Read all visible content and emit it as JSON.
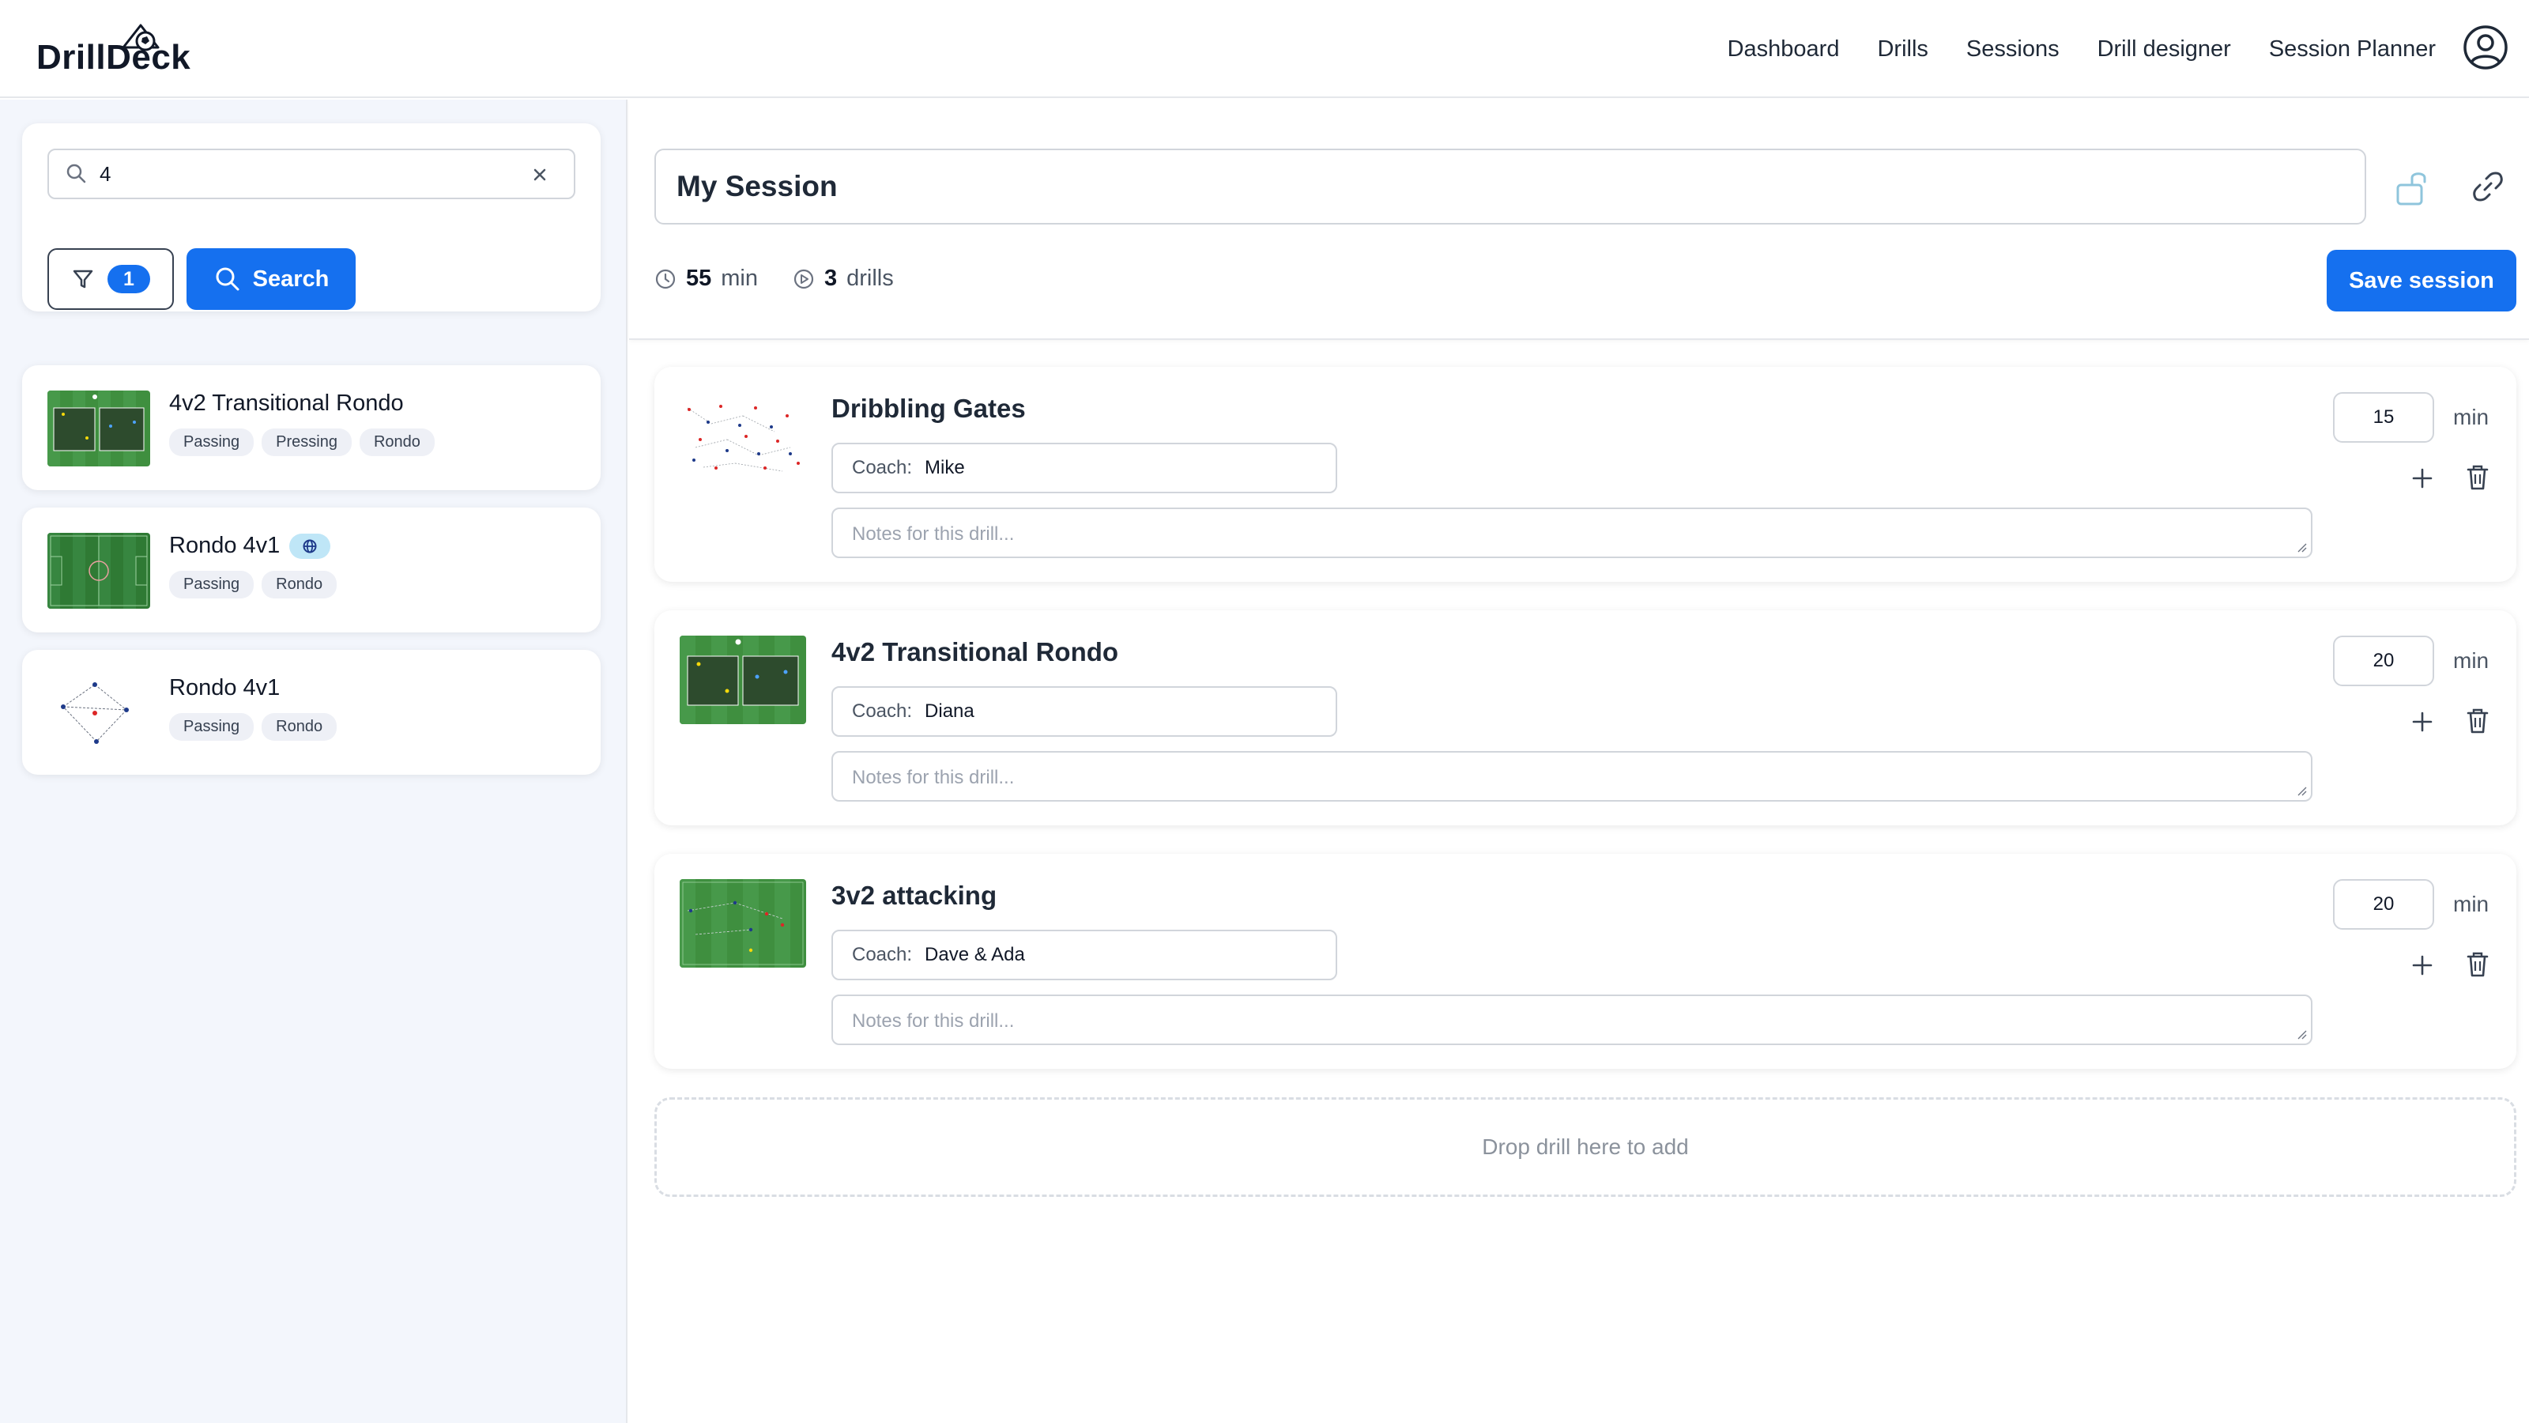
{
  "app": {
    "name": "DrillDeck"
  },
  "nav": {
    "items": [
      "Dashboard",
      "Drills",
      "Sessions",
      "Drill designer",
      "Session Planner"
    ]
  },
  "colors": {
    "primary": "#1570ef",
    "pitch_green": "#3a8a3a",
    "pitch_dark": "#2b5f2b",
    "tag_bg": "#eef0f6",
    "globe_badge": "#bfe6f7"
  },
  "search": {
    "value": "4",
    "filter_count": "1",
    "button_label": "Search"
  },
  "library": {
    "items": [
      {
        "title": "4v2 Transitional Rondo",
        "tags": [
          "Passing",
          "Pressing",
          "Rondo"
        ],
        "shared": false
      },
      {
        "title": "Rondo 4v1",
        "tags": [
          "Passing",
          "Rondo"
        ],
        "shared": true
      },
      {
        "title": "Rondo 4v1",
        "tags": [
          "Passing",
          "Rondo"
        ],
        "shared": false
      }
    ]
  },
  "session": {
    "name": "My Session",
    "total_minutes": "55",
    "minutes_unit": "min",
    "drill_count": "3",
    "drills_unit": "drills",
    "save_label": "Save session",
    "coach_label": "Coach:",
    "notes_placeholder": "Notes for this drill...",
    "minutes_label": "min",
    "drills": [
      {
        "title": "Dribbling Gates",
        "coach": "Mike",
        "minutes": "15"
      },
      {
        "title": "4v2 Transitional Rondo",
        "coach": "Diana",
        "minutes": "20"
      },
      {
        "title": "3v2 attacking",
        "coach": "Dave & Ada",
        "minutes": "20"
      }
    ],
    "drop_hint": "Drop drill here to add"
  },
  "icons": {
    "logo": "ball-cone-logo-icon",
    "user": "user-circle-icon",
    "search": "search-icon",
    "clear": "close-icon",
    "filter": "filter-icon",
    "globe": "globe-icon",
    "lock": "unlock-icon",
    "link": "link-icon",
    "clock": "clock-icon",
    "play": "play-circle-icon",
    "plus": "plus-icon",
    "trash": "trash-icon"
  }
}
